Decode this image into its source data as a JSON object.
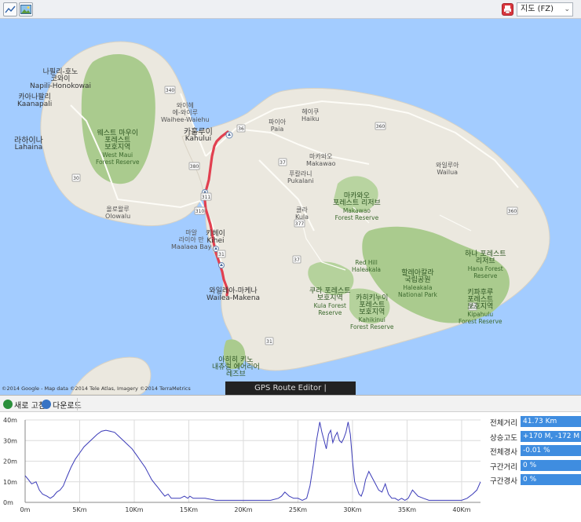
{
  "toolbar": {
    "map_type_value": "지도 (FZ)"
  },
  "map": {
    "banner": "GPS Route Editor | www.gpsnote.net",
    "copyright": "©2014 Google - Map data ©2014 Tele Atlas, Imagery ©2014 TerraMetrics",
    "labels": {
      "napili_ko": "나필리-호노",
      "napili_ko2": "코와이",
      "napili_en": "Napili-Honokowai",
      "kaanapali_ko": "카아나팔리",
      "kaanapali_en": "Kaanapali",
      "lahaina_ko": "라하이나",
      "lahaina_en": "Lahaina",
      "waihee_ko": "와이헤",
      "waihee_ko2": "에-와이루",
      "waihee_en": "Waihee-Waiehu",
      "kahului_ko": "카훌루이",
      "kahului_en": "Kahului",
      "paia_ko": "파이아",
      "paia_en": "Paia",
      "haiku_ko": "헤이쿠",
      "haiku_en": "Haiku",
      "makawao_ko": "마카와오",
      "makawao_en": "Makawao",
      "pukalani_ko": "푸칼라니",
      "pukalani_en": "Pukalani",
      "kula_ko": "쿨라",
      "kula_en": "Kula",
      "wailua_ko": "와일루아",
      "wailua_en": "Wailua",
      "olowalu_ko": "올로왈루",
      "olowalu_en": "Olowalu",
      "maalaea_ko": "마알",
      "maalaea_ko2": "라이아 만",
      "maalaea_en": "Maalaea Bay",
      "kihei_ko": "키헤이",
      "kihei_en": "Kihei",
      "wailea_ko": "와일레아-마케나",
      "wailea_en": "Wailea-Makena",
      "wmaui_1": "웨스트 마우이",
      "wmaui_2": "포레스트",
      "wmaui_3": "보호지역",
      "wmaui_4": "West Maui",
      "wmaui_5": "Forest Reserve",
      "makawao_fr_1": "마카와오",
      "makawao_fr_2": "포레스트 리저브",
      "makawao_fr_3": "Makawao",
      "makawao_fr_4": "Forest Reserve",
      "hanafr_1": "하나 포레스트",
      "hanafr_2": "리저브",
      "hanafr_3": "Hana Forest",
      "hanafr_4": "Reserve",
      "haleakala_1": "할레아칼라",
      "haleakala_2": "국립공원",
      "haleakala_3": "Haleakala",
      "haleakala_4": "National Park",
      "redhill_1": "Red Hill",
      "redhill_2": "Haleakala",
      "kulafr_1": "쿠라 포레스트",
      "kulafr_2": "보호지역",
      "kulafr_3": "Kula Forest",
      "kulafr_4": "Reserve",
      "kahikinui_1": "카히키누이",
      "kahikinui_2": "포레스트",
      "kahikinui_3": "보호지역",
      "kahikinui_4": "Kahikinui",
      "kahikinui_5": "Forest Reserve",
      "kipahulu_1": "키파후루",
      "kipahulu_2": "포레스트",
      "kipahulu_3": "보호지역",
      "kipahulu_4": "Kipahulu",
      "kipahulu_5": "Forest Reserve",
      "ahihi_1": "아히히 키노",
      "ahihi_2": "내츄럴 에어리어",
      "ahihi_3": "레즈브",
      "road_340": "340",
      "road_380": "380",
      "road_36": "36",
      "road_37": "37",
      "road_360": "360",
      "road_310": "310",
      "road_311": "311",
      "road_31": "31",
      "road_377": "377",
      "road_30": "30"
    }
  },
  "bottombar": {
    "refresh_label": "새로 고침",
    "download_label": "다운로드"
  },
  "stats": [
    {
      "label": "전체거리",
      "value": "41.73 Km"
    },
    {
      "label": "상승고도",
      "value": "+170 M, -172 M"
    },
    {
      "label": "전체경사",
      "value": "-0.01 %"
    },
    {
      "label": "구간거리",
      "value": "0 %"
    },
    {
      "label": "구간경사",
      "value": "0 %"
    }
  ],
  "chart_data": {
    "type": "line",
    "xlabel": "",
    "ylabel": "",
    "x_ticks": [
      "0m",
      "5Km",
      "10Km",
      "15Km",
      "20Km",
      "25Km",
      "30Km",
      "35Km",
      "40Km"
    ],
    "y_ticks": [
      "0m",
      "10m",
      "20m",
      "30m",
      "40m"
    ],
    "xlim": [
      0,
      41.73
    ],
    "ylim": [
      0,
      40
    ],
    "grid": true,
    "color": "#3a3ab8",
    "series": [
      {
        "x": [
          0,
          0.3,
          0.6,
          1.0,
          1.3,
          1.6,
          2.0,
          2.3,
          2.6,
          2.9,
          3.2,
          3.5,
          3.8,
          4.2,
          4.6,
          5.0,
          5.4,
          5.8,
          6.2,
          6.6,
          7.0,
          7.4,
          7.8,
          8.2,
          8.6,
          9.0,
          9.4,
          9.8,
          10.2,
          10.6,
          11.0,
          11.3,
          11.6,
          11.9,
          12.2,
          12.5,
          12.8,
          13.1,
          13.4,
          13.8,
          14.2,
          14.6,
          14.9,
          15.1,
          15.4,
          15.8,
          16.5,
          17.5,
          18.5,
          19.5,
          20.5,
          21.5,
          22.5,
          23.2,
          23.5,
          23.8,
          24.2,
          24.6,
          25.0,
          25.4,
          25.8,
          26.1,
          26.4,
          26.7,
          27.0,
          27.2,
          27.4,
          27.6,
          27.8,
          28.0,
          28.2,
          28.4,
          28.6,
          28.8,
          29.0,
          29.2,
          29.4,
          29.6,
          29.8,
          30.0,
          30.2,
          30.4,
          30.6,
          30.8,
          31.0,
          31.2,
          31.5,
          31.8,
          32.1,
          32.4,
          32.7,
          33.0,
          33.3,
          33.6,
          33.9,
          34.2,
          34.5,
          34.8,
          35.1,
          35.5,
          36.0,
          36.5,
          37.0,
          37.5,
          38.0,
          38.5,
          39.0,
          39.5,
          40.0,
          40.5,
          41.0,
          41.4,
          41.73
        ],
        "y": [
          13,
          11,
          9,
          10,
          6,
          4,
          3,
          2,
          3,
          5,
          6,
          8,
          12,
          17,
          21,
          24,
          27,
          29,
          31,
          33,
          34.5,
          35,
          34.5,
          34,
          32,
          30,
          28,
          26,
          23,
          20,
          17,
          14,
          11,
          9,
          7,
          5,
          3,
          4,
          2,
          2,
          2,
          3,
          2,
          3,
          2,
          2,
          2,
          1,
          1,
          1,
          1,
          1,
          1,
          2,
          3,
          5,
          3,
          2,
          2,
          1,
          2,
          8,
          18,
          30,
          39,
          34,
          30,
          26,
          33,
          35,
          29,
          32,
          34,
          30,
          29,
          31,
          34,
          39,
          33,
          20,
          10,
          7,
          4,
          3,
          6,
          11,
          15,
          12,
          9,
          6,
          5,
          9,
          4,
          2,
          2,
          1,
          2,
          1,
          2,
          6,
          3,
          2,
          1,
          1,
          1,
          1,
          1,
          1,
          1,
          2,
          4,
          6,
          10
        ]
      }
    ]
  }
}
